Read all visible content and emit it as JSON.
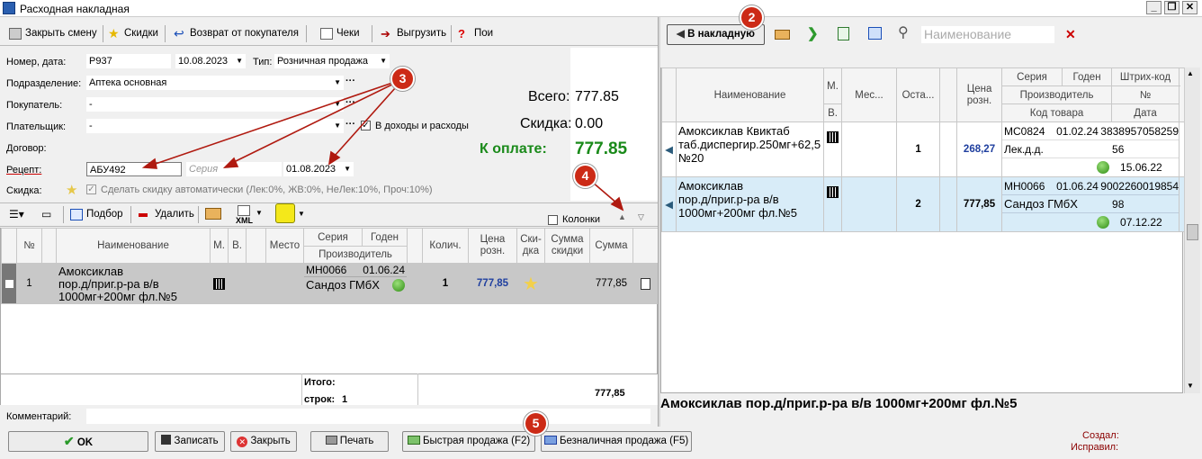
{
  "window": {
    "title": "Расходная накладная",
    "min": "_",
    "max": "❐",
    "close": "✕"
  },
  "toolbar": {
    "close_shift": "Закрыть смену",
    "discounts": "Скидки",
    "return": "Возврат от покупателя",
    "checks": "Чеки",
    "export": "Выгрузить",
    "help": "Пои"
  },
  "form": {
    "number_date_label": "Номер, дата:",
    "number": "Р937",
    "date": "10.08.2023",
    "type_label": "Тип:",
    "type": "Розничная продажа",
    "department_label": "Подразделение:",
    "department": "Аптека основная",
    "buyer_label": "Покупатель:",
    "buyer": "-",
    "payer_label": "Плательщик:",
    "payer": "-",
    "income_label": "В доходы и расходы",
    "contract_label": "Договор:",
    "recipe_label": "Рецепт:",
    "recipe": "АБУ492",
    "series_placeholder": "Серия",
    "recipe_date": "01.08.2023",
    "discount_label": "Скидка:",
    "auto_discount": "Сделать скидку автоматически (Лек:0%, ЖВ:0%, НеЛек:10%, Проч:10%)"
  },
  "totals": {
    "total_label": "Всего:",
    "total": "777.85",
    "discount_label": "Скидка:",
    "discount": "0.00",
    "pay_label": "К оплате:",
    "pay": "777.85"
  },
  "items_toolbar": {
    "select": "Подбор",
    "delete": "Удалить",
    "xml": "XML",
    "columns": "Колонки"
  },
  "items_table": {
    "headers": {
      "num": "№",
      "name": "Наименование",
      "m": "М.",
      "v": "В.",
      "place": "Место",
      "series": "Серия",
      "expiry": "Годен",
      "producer": "Производитель",
      "qty": "Колич.",
      "price": "Цена розн.",
      "disc": "Ски-дка",
      "disc_sum": "Сумма скидки",
      "sum": "Сумма"
    },
    "row": {
      "num": "1",
      "name1": "Амоксиклав",
      "name2": "пор.д/приг.р-ра в/в",
      "name3": "1000мг+200мг фл.№5",
      "series": "МН0066",
      "expiry": "01.06.24",
      "producer": "Сандоз ГМбХ",
      "qty": "1",
      "price": "777,85",
      "sum": "777,85"
    },
    "footer": {
      "total_label": "Итого:",
      "rows_label": "строк:",
      "rows": "1",
      "sum": "777,85"
    }
  },
  "comment_label": "Комментарий:",
  "buttons": {
    "ok": "OK",
    "save": "Записать",
    "close": "Закрыть",
    "print": "Печать",
    "quick_sale": "Быстрая продажа (F2)",
    "cashless_sale": "Безналичная продажа (F5)"
  },
  "status": {
    "created_label": "Создал:",
    "edited_label": "Исправил:"
  },
  "right": {
    "to_invoice": "В накладную",
    "search_placeholder": "Наименование",
    "headers": {
      "name": "Наименование",
      "m": "М.",
      "v": "В.",
      "place": "Мес...",
      "rest": "Оста...",
      "price": "Цена розн.",
      "series": "Серия",
      "expiry": "Годен",
      "barcode": "Штрих-код",
      "producer": "Производитель",
      "no": "№",
      "code": "Код товара",
      "date": "Дата"
    },
    "rows": [
      {
        "name1": "Амоксиклав Квиктаб",
        "name2": "таб.диспергир.250мг+62,5",
        "name3": "№20",
        "rest": "1",
        "price": "268,27",
        "series": "МС0824",
        "expiry": "01.02.24",
        "barcode": "3838957058259",
        "producer": "Лек.д.д.",
        "no": "56",
        "date": "15.06.22"
      },
      {
        "name1": "Амоксиклав",
        "name2": "пор.д/приг.р-ра в/в",
        "name3": "1000мг+200мг фл.№5",
        "rest": "2",
        "price": "777,85",
        "series": "МН0066",
        "expiry": "01.06.24",
        "barcode": "9002260019854",
        "producer": "Сандоз ГМбХ",
        "no": "98",
        "date": "07.12.22"
      }
    ],
    "selected_name": "Амоксиклав пор.д/приг.р-ра в/в 1000мг+200мг фл.№5"
  },
  "callouts": [
    "2",
    "3",
    "4",
    "5"
  ],
  "colors": {
    "accent": "#cc2a16",
    "pay_green": "#1a8a1a",
    "selection": "#d8ecf8",
    "price_blue": "#1f3f9f"
  }
}
